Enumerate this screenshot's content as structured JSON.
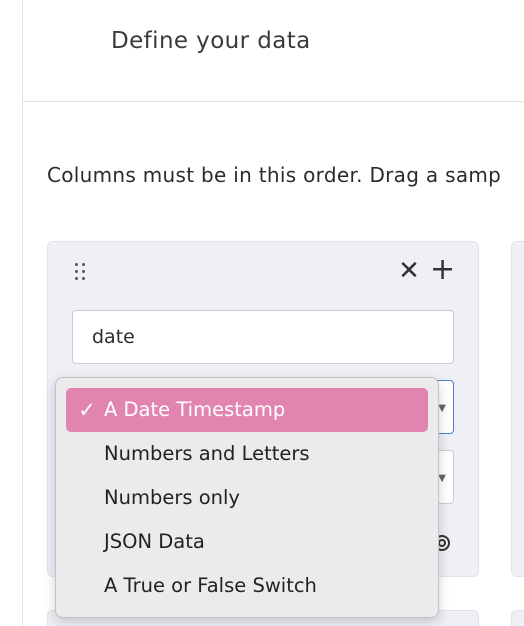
{
  "header": {
    "title": "Define your data"
  },
  "instructions": "Columns must be in this order. Drag a samp",
  "column": {
    "name_value": "date",
    "type_options": [
      {
        "label": "A Date Timestamp",
        "selected": true
      },
      {
        "label": "Numbers and Letters",
        "selected": false
      },
      {
        "label": "Numbers only",
        "selected": false
      },
      {
        "label": "JSON Data",
        "selected": false
      },
      {
        "label": "A True or False Switch",
        "selected": false
      }
    ],
    "selected_check": "✓",
    "remove_glyph": "✕",
    "add_glyph": "+"
  },
  "colors": {
    "selected_option": "#e184b0",
    "focus_border": "#4a7bd0",
    "card_bg": "#eef0f6"
  }
}
